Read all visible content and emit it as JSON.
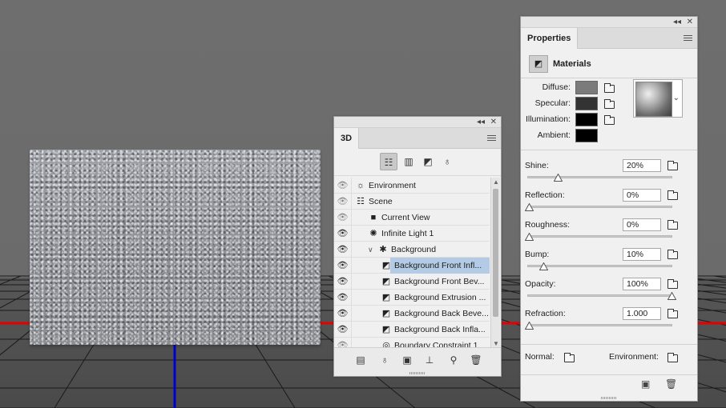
{
  "panel3d": {
    "tab": "3D",
    "filters": [
      "scene-filter",
      "mesh-filter",
      "material-filter",
      "light-filter"
    ],
    "tree": [
      {
        "label": "Environment",
        "icon": "environment-icon",
        "indent": 0,
        "eye": "dim"
      },
      {
        "label": "Scene",
        "icon": "scene-icon",
        "indent": 0,
        "eye": "dim"
      },
      {
        "label": "Current View",
        "icon": "camera-icon",
        "indent": 1,
        "eye": "dim"
      },
      {
        "label": "Infinite Light 1",
        "icon": "light-icon",
        "indent": 1,
        "eye": "on"
      },
      {
        "label": "Background",
        "icon": "mesh-icon",
        "indent": 1,
        "eye": "on",
        "expanded": true
      },
      {
        "label": "Background Front Infl...",
        "icon": "material-icon",
        "indent": 2,
        "eye": "on",
        "selected": true
      },
      {
        "label": "Background Front Bev...",
        "icon": "material-icon",
        "indent": 2,
        "eye": "on"
      },
      {
        "label": "Background Extrusion ...",
        "icon": "material-icon",
        "indent": 2,
        "eye": "on"
      },
      {
        "label": "Background Back Beve...",
        "icon": "material-icon",
        "indent": 2,
        "eye": "on"
      },
      {
        "label": "Background Back Infla...",
        "icon": "material-icon",
        "indent": 2,
        "eye": "on"
      },
      {
        "label": "Boundary Constraint 1",
        "icon": "constraint-icon",
        "indent": 2,
        "eye": "dim"
      }
    ]
  },
  "props": {
    "tab": "Properties",
    "section": "Materials",
    "swatches": [
      {
        "label": "Diffuse:",
        "color": "#7b7b7b",
        "icon": "edit-texture-icon"
      },
      {
        "label": "Specular:",
        "color": "#333333",
        "icon": "folder-icon"
      },
      {
        "label": "Illumination:",
        "color": "#000000",
        "icon": "folder-icon"
      },
      {
        "label": "Ambient:",
        "color": "#000000",
        "icon": ""
      }
    ],
    "sliders": [
      {
        "label": "Shine:",
        "value": "20%",
        "fraction": 0.2
      },
      {
        "label": "Reflection:",
        "value": "0%",
        "fraction": 0
      },
      {
        "label": "Roughness:",
        "value": "0%",
        "fraction": 0
      },
      {
        "label": "Bump:",
        "value": "10%",
        "fraction": 0.1
      },
      {
        "label": "Opacity:",
        "value": "100%",
        "fraction": 1
      },
      {
        "label": "Refraction:",
        "value": "1.000",
        "fraction": 0
      }
    ],
    "normal_label": "Normal:",
    "environment_label": "Environment:"
  },
  "colors": {
    "axis_x": "#e60000",
    "axis_z": "#0000cc",
    "selection": "#b4cbe6"
  }
}
